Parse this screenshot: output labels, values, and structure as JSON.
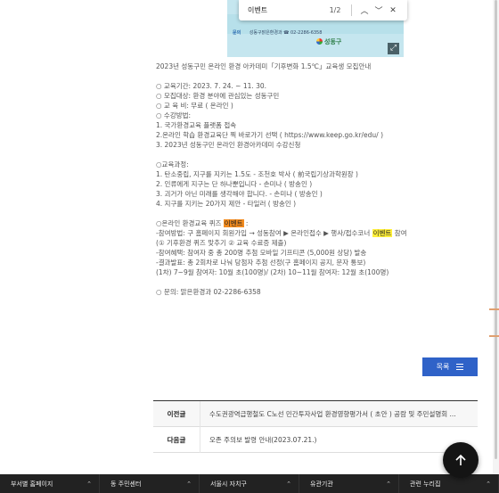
{
  "poster": {
    "sponsor_label": "문의",
    "sponsor_text": "성동구맑은환경과  ☎ 02-2286-6358",
    "logo_text": "성동구",
    "expand_icon": "expand-icon"
  },
  "find_bar": {
    "query": "이벤트",
    "count": "1/2",
    "prev_icon": "chevron-up-icon",
    "next_icon": "chevron-down-icon",
    "close_icon": "close-icon"
  },
  "article": {
    "title": "2023년 성동구민 온라인 환경 아카데미「기후변화 1.5℃」교육생 모집안내",
    "period": "○ 교육기간: 2023. 7. 24. ~ 11. 30.",
    "target": "○ 모집대상: 환경 분야에 관심있는 성동구민",
    "fee": "○ 교 육 비: 무료 ( 온라인 )",
    "method_title": "○ 수강방법:",
    "method_1": "1. 국가환경교육 플랫폼 접속",
    "method_2": "2.온라인 학습 환경교육단 찍 바로가기 선택 ( https://www.keep.go.kr/edu/ )",
    "method_3": "3. 2023년 성동구민 온라인 환경아카데미 수강신청",
    "course_title": "○교육과정:",
    "course_1": "1. 탄소중립, 지구를 지키는 1.5도 - 조천호 박사 ( 前국립기상과학원장 )",
    "course_2": "2. 인류에게 지구는 단 하나뿐입니다 - 손미나 ( 방송인 )",
    "course_3": "3. 괴거가 아닌 미래를 생각해야 합니다. - 손미나 ( 방송인 )",
    "course_4": "4. 지구를 지키는 20가지 제안 - 타일러 ( 방송인 )",
    "quiz_prefix": "○온라인 환경교육 퀴즈 ",
    "quiz_highlight": "이벤트",
    "quiz_suffix": " :",
    "join_prefix": "-참여방법: 구 홈페이지 회원가입 → 성동참여 ▶ 온라인접수 ▶ 행사/접수코너 ",
    "join_highlight": "이벤트",
    "join_suffix": " 참여",
    "join_detail": "(① 기후환경 퀴즈 맞추기 ② 교육 수료증 제출)",
    "benefit": "-참여혜택: 참여자 중 총 200명 추첨 모바일 기프티콘 (5,000원 상당) 발송",
    "result": "-결과발표: 총 2회차로 나눠 당첨자 추첨 선정(구 홈페이지 공지, 문자 통보)",
    "rounds": "(1차) 7~9월 참여자: 10월 초(100명)/ (2차) 10~11월 참여자: 12월 초(100명)",
    "contact": "○ 문의: 맑은환경과 02-2286-6358"
  },
  "toc_button": {
    "label": "목록",
    "icon": "menu-icon"
  },
  "nav": {
    "prev_label": "이전글",
    "prev_title": "수도권광역급행철도 C노선 민간투자사업 환경영향평가서 ( 초안 ) 공람 및 주민설명회 ...",
    "next_label": "다음글",
    "next_title": "오존 주의보 발령 안내(2023.07.21.)"
  },
  "footer": {
    "items": [
      {
        "label": "부서별 홈페이지"
      },
      {
        "label": "동 주민센터"
      },
      {
        "label": "서울시 자치구"
      },
      {
        "label": "유관기관"
      },
      {
        "label": "관련 누리집"
      }
    ]
  },
  "top_button": {
    "icon": "arrow-up-icon"
  },
  "colors": {
    "highlight_current": "#f28b1f",
    "highlight_other": "#ffef3a",
    "accent": "#2f62c8",
    "footer": "#222222"
  }
}
